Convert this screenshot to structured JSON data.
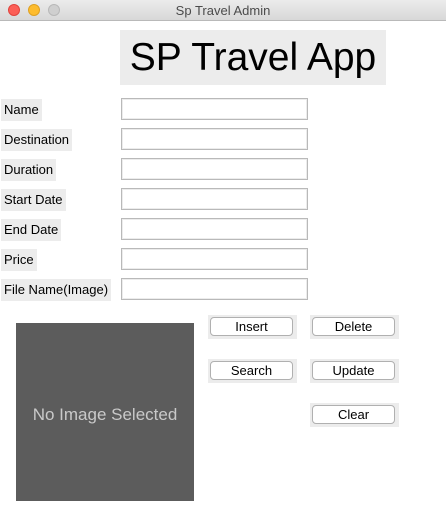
{
  "window": {
    "title": "Sp Travel Admin"
  },
  "app_title": "SP Travel App",
  "form": {
    "fields": [
      {
        "label": "Name",
        "value": ""
      },
      {
        "label": "Destination",
        "value": ""
      },
      {
        "label": "Duration",
        "value": ""
      },
      {
        "label": "Start Date",
        "value": ""
      },
      {
        "label": "End Date",
        "value": ""
      },
      {
        "label": "Price",
        "value": ""
      },
      {
        "label": "File Name(Image)",
        "value": ""
      }
    ]
  },
  "image_panel": {
    "placeholder": "No Image Selected"
  },
  "buttons": {
    "insert": "Insert",
    "delete": "Delete",
    "search": "Search",
    "update": "Update",
    "clear": "Clear"
  },
  "colors": {
    "panel_bg": "#5c5c5c",
    "label_bg": "#ececec"
  }
}
